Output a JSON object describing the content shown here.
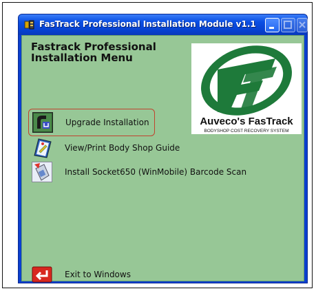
{
  "window": {
    "title": "FasTrack Professional Installation Module v1.1"
  },
  "menu": {
    "heading": "Fastrack Professional Installation Menu",
    "items": [
      {
        "label": "Upgrade Installation",
        "icon": "upgrade-icon",
        "selected": true
      },
      {
        "label": "View/Print Body Shop Guide",
        "icon": "guide-book-icon",
        "selected": false
      },
      {
        "label": "Install Socket650 (WinMobile) Barcode Scan",
        "icon": "barcode-scanner-icon",
        "selected": false
      }
    ],
    "exit_label": "Exit to Windows"
  },
  "logo": {
    "brand": "Auveco's FasTrack",
    "tagline": "BODYSHOP COST RECOVERY SYSTEM",
    "mark": "FT"
  },
  "colors": {
    "client_bg": "#97c796",
    "titlebar": "#0b4fe3",
    "logo_green": "#1e7a3a",
    "selection": "#c0422e"
  }
}
